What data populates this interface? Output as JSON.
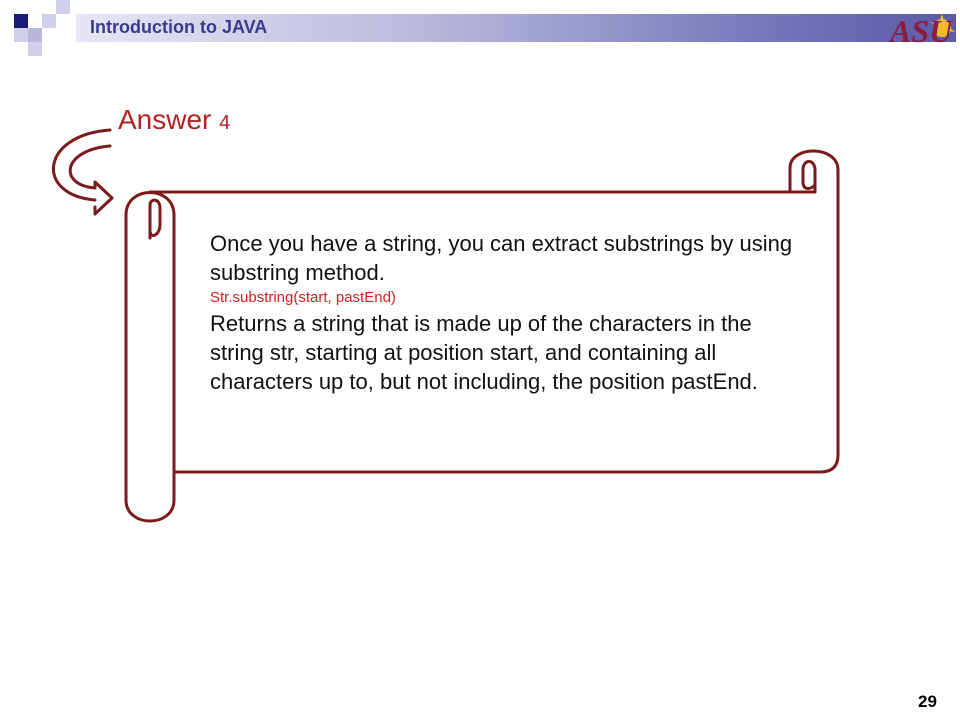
{
  "header": {
    "title": "Introduction to JAVA",
    "logo_text": "ASU"
  },
  "slide": {
    "heading": "Answer",
    "heading_number": "4",
    "paragraph_1": "Once you have a string, you can extract substrings by using substring method.",
    "code_line": "Str.substring(start,  pastEnd)",
    "paragraph_2": "Returns a string that is made up of the characters in the string str, starting at position start, and containing all characters up to, but not including, the position pastEnd."
  },
  "page_number": "29",
  "colors": {
    "maroon": "#7a1a1a",
    "accent_red": "#b22222",
    "header_blue": "#3a3a8c",
    "asu_gold": "#f2b830"
  }
}
